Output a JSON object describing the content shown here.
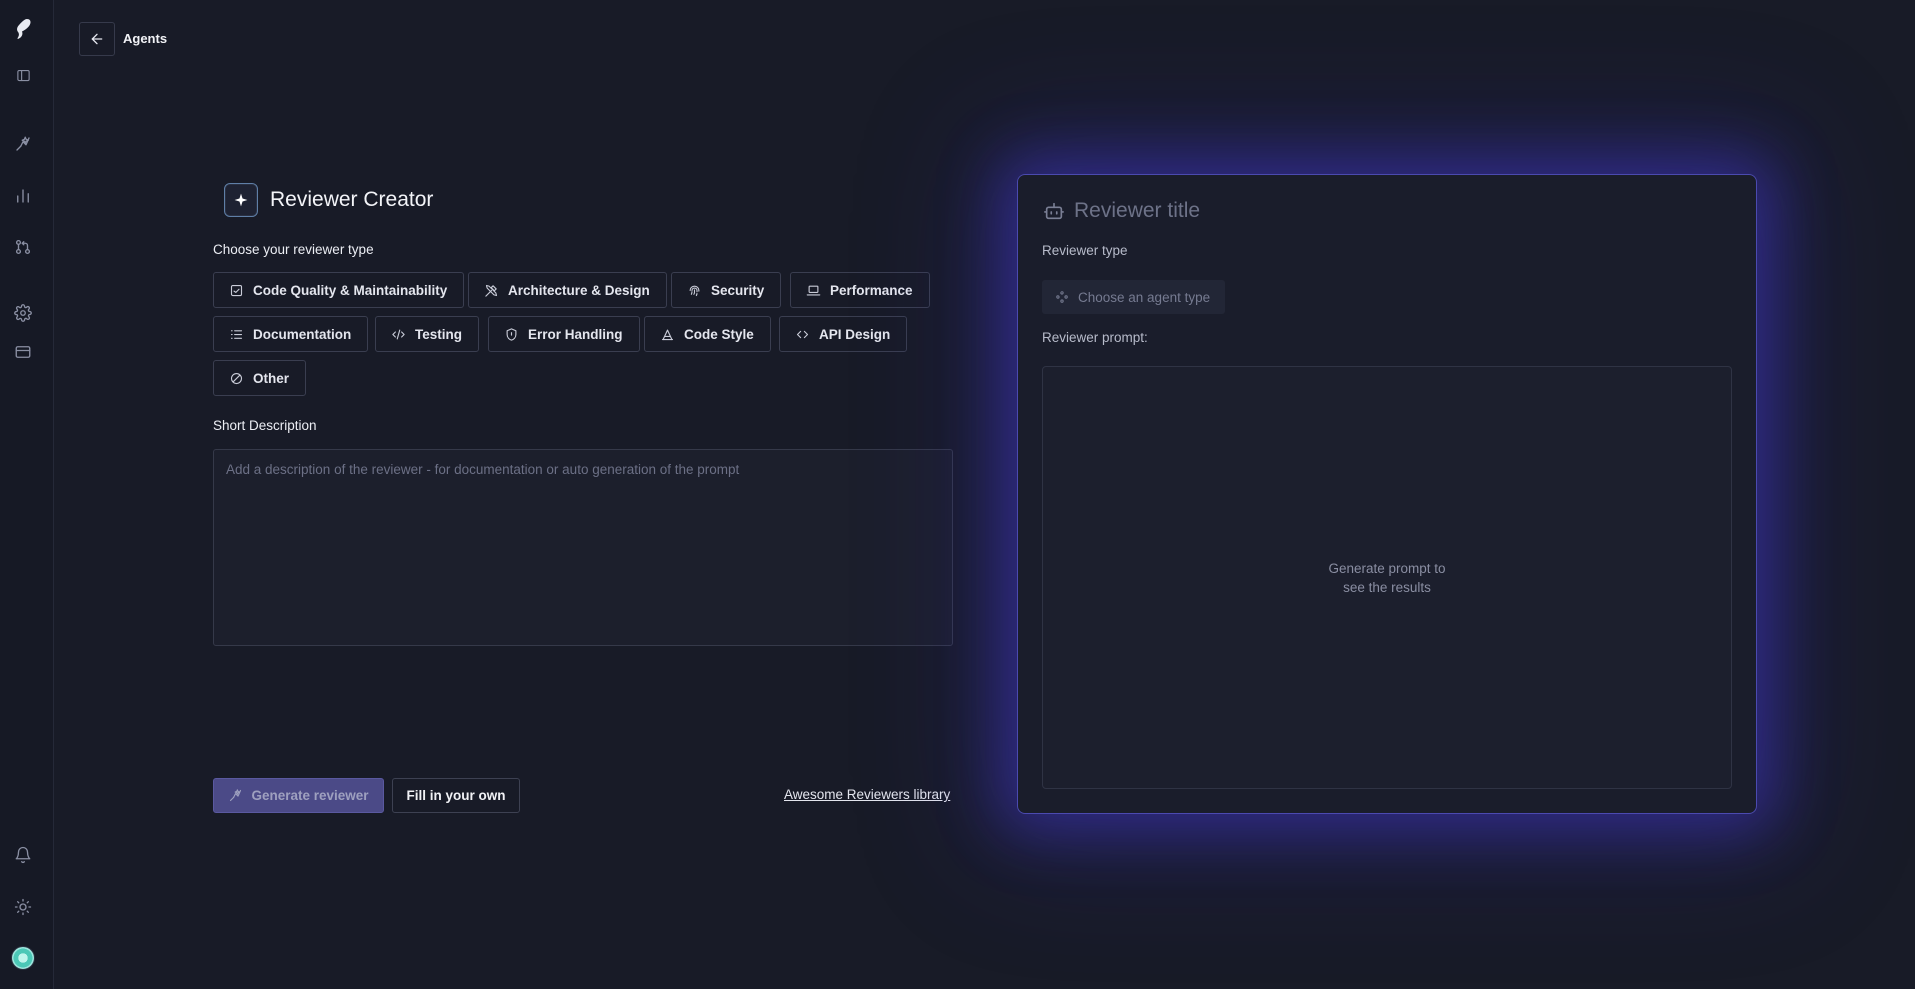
{
  "header": {
    "breadcrumb": "Agents"
  },
  "sidebar": {
    "items": [
      "logo-icon",
      "panel-toggle-icon",
      "agents-icon",
      "chart-icon",
      "pull-request-icon",
      "settings-icon",
      "billing-icon",
      "bell-icon",
      "theme-icon",
      "avatar"
    ]
  },
  "creator": {
    "title": "Reviewer Creator",
    "type_label": "Choose your reviewer type",
    "types": [
      {
        "label": "Code Quality & Maintainability",
        "icon": "file-check-icon"
      },
      {
        "label": "Architecture & Design",
        "icon": "tools-icon"
      },
      {
        "label": "Security",
        "icon": "fingerprint-icon"
      },
      {
        "label": "Performance",
        "icon": "laptop-icon"
      },
      {
        "label": "Documentation",
        "icon": "list-icon"
      },
      {
        "label": "Testing",
        "icon": "code-slash-icon"
      },
      {
        "label": "Error Handling",
        "icon": "shield-icon"
      },
      {
        "label": "Code Style",
        "icon": "style-icon"
      },
      {
        "label": "API Design",
        "icon": "code-icon"
      },
      {
        "label": "Other",
        "icon": "slash-circle-icon"
      }
    ],
    "description_label": "Short Description",
    "description_placeholder": "Add a description of the reviewer - for documentation or auto generation of the prompt",
    "generate_label": "Generate reviewer",
    "fill_label": "Fill in your own",
    "library_link": "Awesome Reviewers library"
  },
  "preview": {
    "title_placeholder": "Reviewer title",
    "type_label": "Reviewer type",
    "type_placeholder": "Choose an agent type",
    "prompt_label": "Reviewer prompt:",
    "prompt_line1": "Generate prompt to",
    "prompt_line2": "see the results"
  },
  "colors": {
    "accent": "#4b4a87",
    "background": "#181b27",
    "glow": "#4b4ab0"
  }
}
